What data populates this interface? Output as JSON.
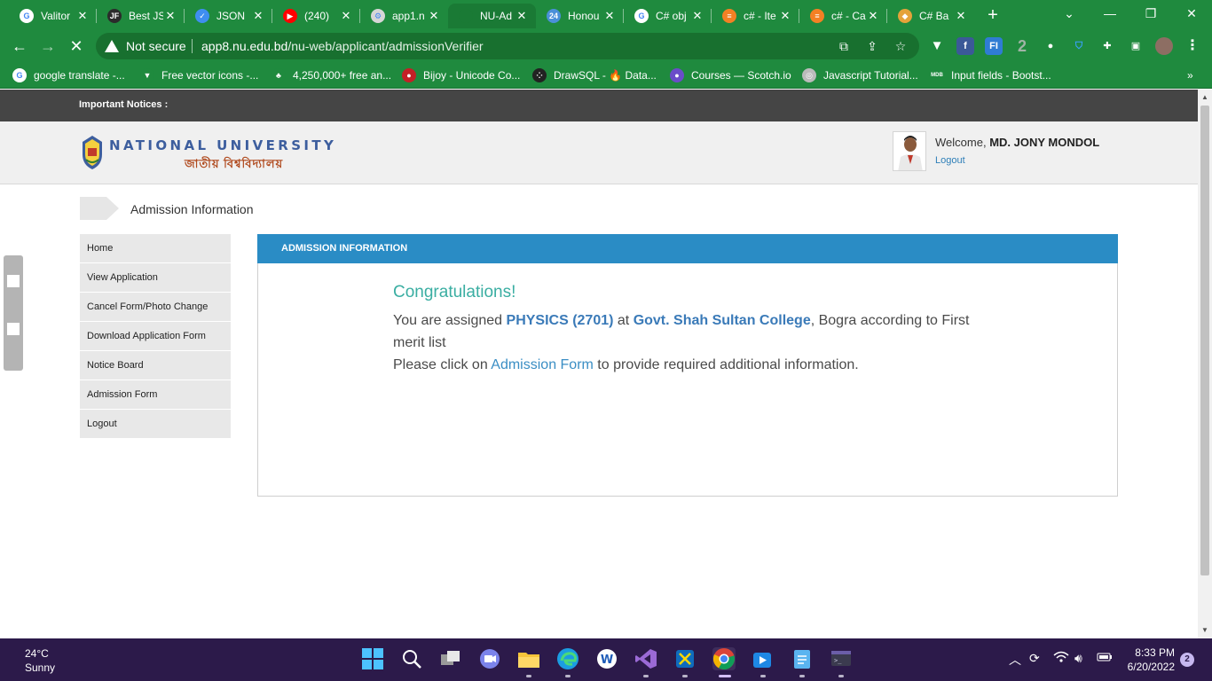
{
  "browser": {
    "tabs": [
      {
        "title": "Valitor",
        "fav": "google-icon",
        "favColor": "#ffffff",
        "glyph": "G"
      },
      {
        "title": "Best JS",
        "fav": "jf-icon",
        "favColor": "#2b2b2b",
        "glyph": "JF"
      },
      {
        "title": "JSON",
        "fav": "checkbox-icon",
        "favColor": "#3f8ef0",
        "glyph": "✓"
      },
      {
        "title": "(240)",
        "fav": "youtube-icon",
        "favColor": "#ff0000",
        "glyph": "▶"
      },
      {
        "title": "app1.n",
        "fav": "nu-icon",
        "favColor": "#d6d6d6",
        "glyph": "⚙"
      },
      {
        "title": "NU-Ad",
        "fav": "loading-icon",
        "favColor": "#1a7a35",
        "glyph": ""
      },
      {
        "title": "Honou",
        "fav": "ebs-icon",
        "favColor": "#4a90d9",
        "glyph": "24"
      },
      {
        "title": "C# obj",
        "fav": "google-icon",
        "favColor": "#ffffff",
        "glyph": "G"
      },
      {
        "title": "c# - Ite",
        "fav": "stackoverflow-icon",
        "favColor": "#f48024",
        "glyph": "≡"
      },
      {
        "title": "c# - Ca",
        "fav": "stackoverflow-icon",
        "favColor": "#f48024",
        "glyph": "≡"
      },
      {
        "title": "C# Ba",
        "fav": "diamond-icon",
        "favColor": "#e5a33a",
        "glyph": "◆"
      }
    ],
    "not_secure": "Not secure",
    "url_host": "app8.nu.edu.bd",
    "url_path": "/nu-web/applicant/admissionVerifier",
    "bookmarks": [
      {
        "label": "google translate -...",
        "icon": "google-icon",
        "color": "#ffffff",
        "glyph": "G"
      },
      {
        "label": "Free vector icons -...",
        "icon": "vector-icon",
        "color": "#1f8a3e",
        "glyph": "▼"
      },
      {
        "label": "4,250,000+ free an...",
        "icon": "lottie-icon",
        "color": "#1f8a3e",
        "glyph": "♣"
      },
      {
        "label": "Bijoy - Unicode Co...",
        "icon": "bijoy-icon",
        "color": "#c42026",
        "glyph": "●"
      },
      {
        "label": "DrawSQL - 🔥 Data...",
        "icon": "drawsql-icon",
        "color": "#222222",
        "glyph": "⁘"
      },
      {
        "label": "Courses — Scotch.io",
        "icon": "scotch-icon",
        "color": "#6a4cc9",
        "glyph": "●"
      },
      {
        "label": "Javascript Tutorial...",
        "icon": "globe-icon",
        "color": "#bbbbbb",
        "glyph": "◎"
      },
      {
        "label": "Input fields - Bootst...",
        "icon": "mdb-icon",
        "color": "#1f8a3e",
        "glyph": "MDB"
      }
    ]
  },
  "page": {
    "notice_label": "Important Notices :",
    "logo_en": "NATIONAL UNIVERSITY",
    "logo_bn": "জাতীয় বিশ্ববিদ্যালয়",
    "welcome_prefix": "Welcome,",
    "user_name": "MD. JONY MONDOL",
    "logout_link": "Logout",
    "breadcrumb": "Admission Information",
    "sidebar": [
      {
        "label": "Home"
      },
      {
        "label": "View Application"
      },
      {
        "label": "Cancel Form/Photo Change"
      },
      {
        "label": "Download Application Form"
      },
      {
        "label": "Notice Board"
      },
      {
        "label": "Admission Form"
      },
      {
        "label": "Logout"
      }
    ],
    "panel_title": "ADMISSION INFORMATION",
    "congrats": "Congratulations!",
    "msg_part1": "You are assigned ",
    "subject": "PHYSICS (2701)",
    "msg_part2": " at ",
    "college": "Govt. Shah Sultan College",
    "msg_part3": ", Bogra according to First merit list",
    "msg_part4": "Please click on ",
    "form_link": "Admission Form",
    "msg_part5": " to provide required additional information."
  },
  "taskbar": {
    "temp": "24°C",
    "condition": "Sunny",
    "time": "8:33 PM",
    "date": "6/20/2022",
    "notifications": "2"
  },
  "colors": {
    "chrome_green": "#1f8a3e",
    "panel_blue": "#2a8cc5",
    "congrats_teal": "#3aaea2",
    "taskbar_purple": "#2c1a4a"
  }
}
